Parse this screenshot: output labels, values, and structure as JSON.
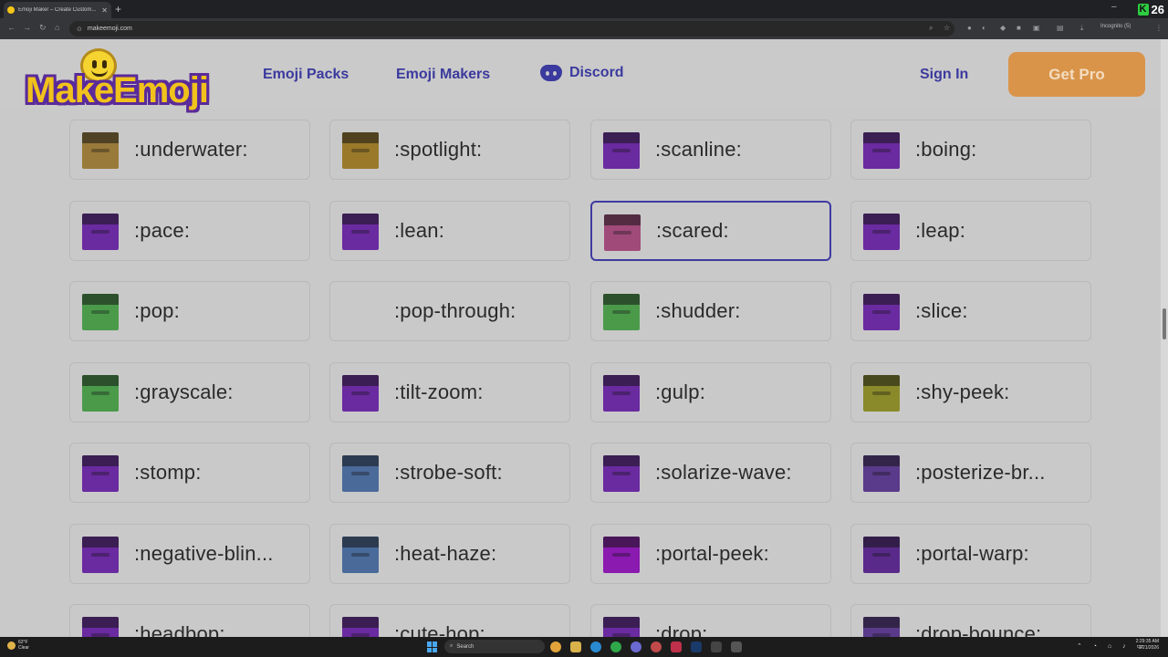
{
  "browser": {
    "tab_title": "Emoji Maker – Create Custom...",
    "tab_close": "✕",
    "new_tab": "+",
    "url": "makeemoji.com",
    "incognito_label": "Incognito (5)",
    "counter_badge": "26",
    "min_glyph": "–",
    "restore_glyph": "❐",
    "close_glyph": "✕"
  },
  "header": {
    "logo_text": "MakeEmoji",
    "nav": {
      "emoji_packs": "Emoji Packs",
      "emoji_makers": "Emoji Makers",
      "discord": "Discord"
    },
    "sign_in": "Sign In",
    "get_pro": "Get Pro"
  },
  "emoji_cards": [
    {
      "label": ":underwater:",
      "tint": "#9a7a3a"
    },
    {
      "label": ":spotlight:",
      "tint": "#9a7a2a"
    },
    {
      "label": ":scanline:",
      "tint": "#6a2aa0"
    },
    {
      "label": ":boing:",
      "tint": "#6a2aa0"
    },
    {
      "label": ":pace:",
      "tint": "#6a2aa0"
    },
    {
      "label": ":lean:",
      "tint": "#6a2aa0"
    },
    {
      "label": ":scared:",
      "tint": "#a04a7a",
      "selected": true
    },
    {
      "label": ":leap:",
      "tint": "#6a2aa0"
    },
    {
      "label": ":pop:",
      "tint": "#4a9a4a"
    },
    {
      "label": ":pop-through:",
      "tint": ""
    },
    {
      "label": ":shudder:",
      "tint": "#4a9a4a"
    },
    {
      "label": ":slice:",
      "tint": "#6a2aa0"
    },
    {
      "label": ":grayscale:",
      "tint": "#4a9a4a"
    },
    {
      "label": ":tilt-zoom:",
      "tint": "#6a2aa0"
    },
    {
      "label": ":gulp:",
      "tint": "#6a2aa0"
    },
    {
      "label": ":shy-peek:",
      "tint": "#8a8a2a"
    },
    {
      "label": ":stomp:",
      "tint": "#6a2aa0"
    },
    {
      "label": ":strobe-soft:",
      "tint": "#4a6a9a"
    },
    {
      "label": ":solarize-wave:",
      "tint": "#6a2aa0"
    },
    {
      "label": ":posterize-br...",
      "tint": "#5a3a8a"
    },
    {
      "label": ":negative-blin...",
      "tint": "#6a2aa0"
    },
    {
      "label": ":heat-haze:",
      "tint": "#4a6a9a"
    },
    {
      "label": ":portal-peek:",
      "tint": "#8a1ab0"
    },
    {
      "label": ":portal-warp:",
      "tint": "#5a2a8a"
    },
    {
      "label": ":headbop:",
      "tint": "#6a2aa0"
    },
    {
      "label": ":cute-hop:",
      "tint": "#6a2aa0"
    },
    {
      "label": ":drop:",
      "tint": "#6a2aa0"
    },
    {
      "label": ":drop-bounce:",
      "tint": "#5a3a8a"
    }
  ],
  "taskbar": {
    "weather_temp": "62°F",
    "weather_cond": "Clear",
    "search": "Search",
    "time": "2:29:35 AM",
    "date": "3/21/2026"
  },
  "colors": {
    "accent": "#3b3a9e",
    "get_pro": "#d9944a"
  }
}
